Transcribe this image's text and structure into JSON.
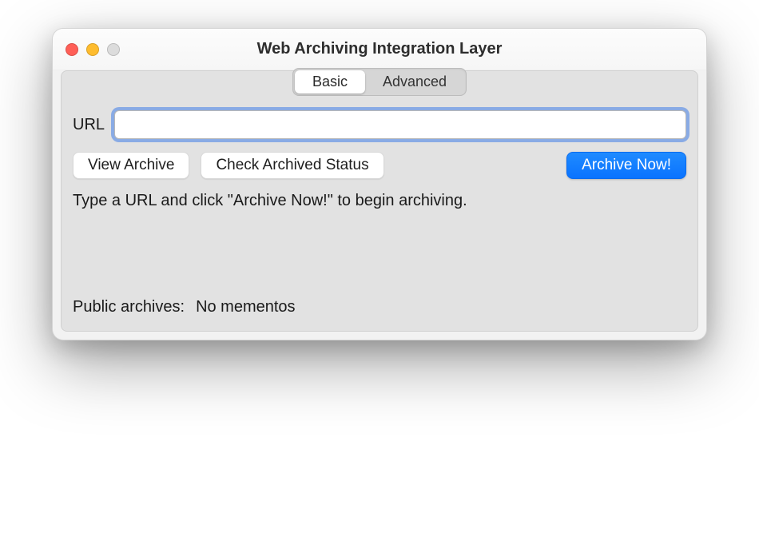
{
  "window": {
    "title": "Web Archiving Integration Layer"
  },
  "tabs": {
    "basic": "Basic",
    "advanced": "Advanced"
  },
  "form": {
    "url_label": "URL",
    "url_value": ""
  },
  "buttons": {
    "view_archive": "View Archive",
    "check_status": "Check Archived Status",
    "archive_now": "Archive Now!"
  },
  "instruction": "Type a URL and click \"Archive Now!\" to begin archiving.",
  "archives": {
    "label": "Public archives:",
    "value": "No mementos"
  }
}
